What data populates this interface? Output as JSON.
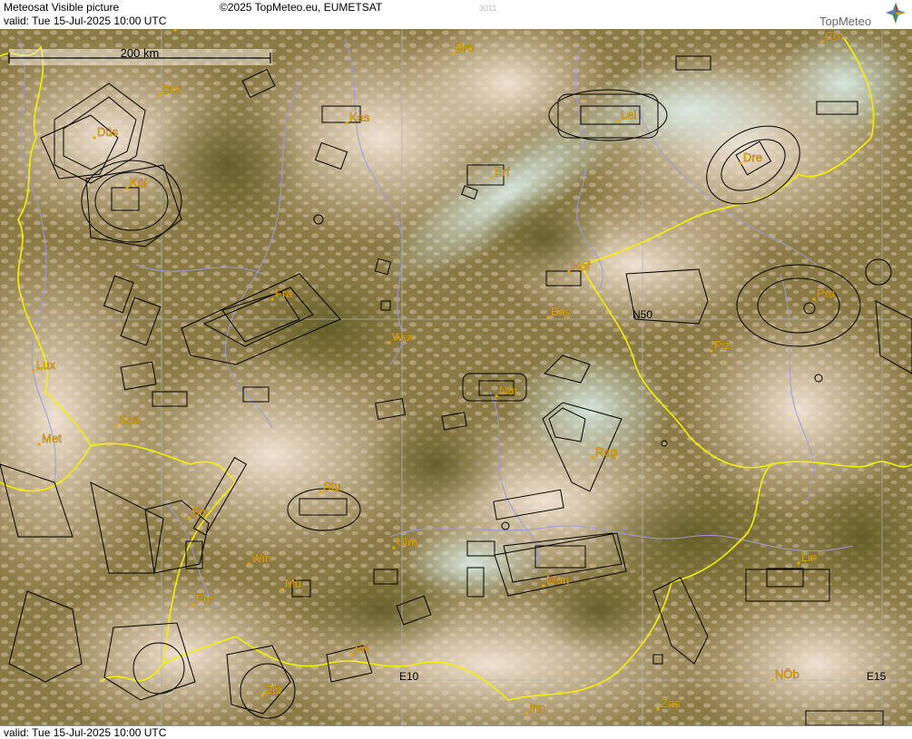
{
  "header": {
    "title": "Meteosat Visible picture",
    "valid": "valid:  Tue  15-Jul-2025  10:00 UTC",
    "copyright": "©2025 TopMeteo.eu, EUMETSAT",
    "frame_id": "3011",
    "logo_text": "TopMeteo"
  },
  "footer": {
    "valid": "valid:  Tue  15-Jul-2025  10:00 UTC"
  },
  "scale_bar": {
    "label": "200 km"
  },
  "grid_labels": {
    "lon_e10": "E10",
    "lon_e15": "E15",
    "lat_n50": "N50"
  },
  "cities": [
    {
      "name": "Mün"
    },
    {
      "name": "Bro"
    },
    {
      "name": "Cot"
    },
    {
      "name": "Dor"
    },
    {
      "name": "Kas"
    },
    {
      "name": "Lei"
    },
    {
      "name": "Düs"
    },
    {
      "name": "Erf"
    },
    {
      "name": "Dre"
    },
    {
      "name": "Köl"
    },
    {
      "name": "Hof"
    },
    {
      "name": "Fra"
    },
    {
      "name": "Pra"
    },
    {
      "name": "Bay"
    },
    {
      "name": "Wür"
    },
    {
      "name": "Plz"
    },
    {
      "name": "Lux"
    },
    {
      "name": "Nür"
    },
    {
      "name": "Saa"
    },
    {
      "name": "Met"
    },
    {
      "name": "Reg"
    },
    {
      "name": "Stu"
    },
    {
      "name": "Str"
    },
    {
      "name": "Ulm"
    },
    {
      "name": "Win"
    },
    {
      "name": "Mü"
    },
    {
      "name": "Mün"
    },
    {
      "name": "Lin"
    },
    {
      "name": "Fre"
    },
    {
      "name": "Fri"
    },
    {
      "name": "Zür"
    },
    {
      "name": "Inn"
    },
    {
      "name": "Zas"
    },
    {
      "name": "NÖb"
    }
  ],
  "colors": {
    "border": "#f5f000",
    "river": "#9b9bdc",
    "airspace": "#000000",
    "city": "#e8a800",
    "grid": "#b0b0b0"
  }
}
